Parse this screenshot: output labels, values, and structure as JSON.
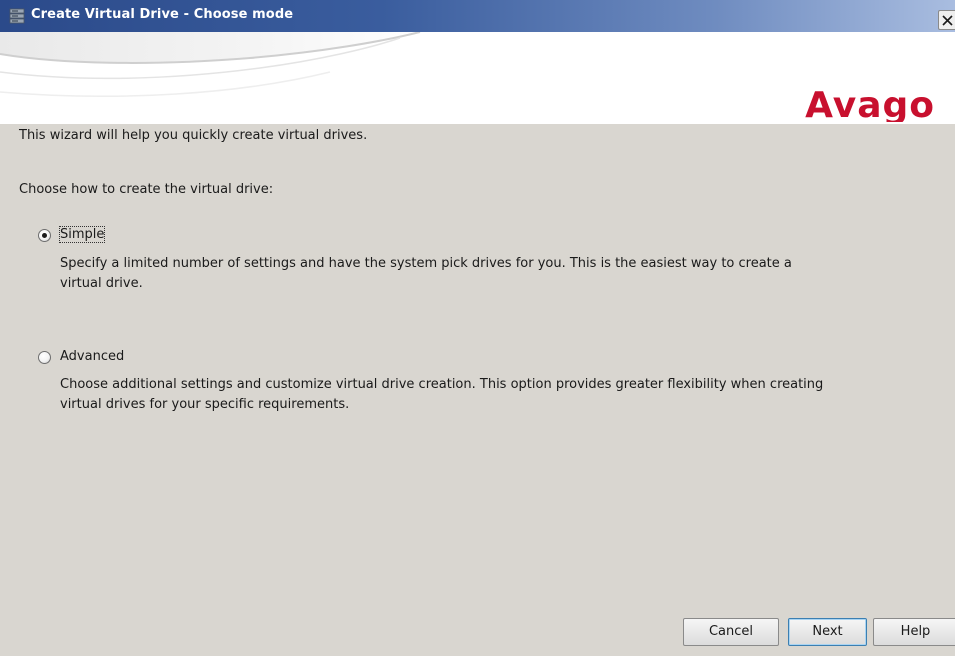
{
  "window": {
    "title": "Create Virtual Drive - Choose mode",
    "title_icon": "storage-drive-icon",
    "close_glyph": "×"
  },
  "banner": {
    "logo_text": "Avago",
    "logo_color": "#c8102e"
  },
  "content": {
    "intro": "This wizard will help you quickly create virtual drives.",
    "prompt": "Choose how to create the virtual drive:",
    "options": [
      {
        "label": "Simple",
        "selected": true,
        "description_line1": "Specify a limited number of settings and have the system pick drives for you. This is the easiest way to create a",
        "description_line2": "virtual drive."
      },
      {
        "label": "Advanced",
        "selected": false,
        "description_line1": "Choose additional settings and customize virtual drive creation. This option provides greater flexibility when creating",
        "description_line2": "virtual drives for your specific requirements."
      }
    ]
  },
  "buttons": {
    "cancel": "Cancel",
    "next": "Next",
    "help": "Help"
  }
}
